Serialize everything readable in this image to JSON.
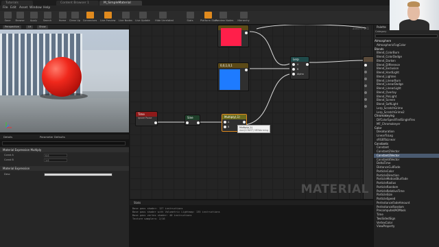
{
  "tabs": [
    {
      "label": "Tutorials"
    },
    {
      "label": "Content Browser 1"
    },
    {
      "label": "M_SimpleMaterial"
    }
  ],
  "menu": [
    "File",
    "Edit",
    "Asset",
    "Window",
    "Help"
  ],
  "toolbar": [
    {
      "label": "Save",
      "icon": "save-icon"
    },
    {
      "label": "Browse",
      "icon": "browse-icon"
    },
    {
      "label": "Apply",
      "icon": "apply-icon"
    },
    {
      "label": "Search",
      "icon": "search-icon"
    },
    {
      "label": "Home",
      "icon": "home-icon"
    },
    {
      "label": "Clean Up",
      "icon": "clean-up-icon"
    },
    {
      "label": "Connectors",
      "icon": "connectors-icon"
    },
    {
      "label": "Live Preview",
      "icon": "live-preview-icon"
    },
    {
      "label": "Live Nodes",
      "icon": "live-nodes-icon"
    },
    {
      "label": "Live Update",
      "icon": "live-update-icon"
    },
    {
      "label": "Hide Unrelated",
      "icon": "hide-unrelated-icon"
    },
    {
      "label": "Stats",
      "icon": "stats-icon"
    },
    {
      "label": "Platform Stats",
      "icon": "platform-stats-icon"
    },
    {
      "label": "Preview Nodes",
      "icon": "preview-nodes-icon"
    },
    {
      "label": "Hierarchy",
      "icon": "hierarchy-icon"
    }
  ],
  "viewport": {
    "buttons": [
      "Perspective",
      "Lit",
      "Show"
    ]
  },
  "details": {
    "tabs": [
      "Details",
      "Parameter Defaults"
    ],
    "section1": "Material Expression Multiply",
    "rows1": [
      {
        "label": "Const A",
        "value": "0.0"
      },
      {
        "label": "Const B",
        "value": "1.0"
      }
    ],
    "section2": "Material Expression",
    "rows2": [
      {
        "label": "Desc",
        "value": ""
      }
    ]
  },
  "graph": {
    "zoom": "Zoom 1:1",
    "watermark": "MATERIAL",
    "nodes": {
      "vector_red": {
        "title": ""
      },
      "vector_blue": {
        "title": "0,0,1,0,1"
      },
      "lerp": {
        "title": "Lerp",
        "pins": [
          "A",
          "B",
          "Alpha"
        ]
      },
      "time": {
        "title": "Time",
        "subtitle": "Ignore Pause"
      },
      "sine": {
        "title": "Sine"
      },
      "multiply": {
        "title": "Multiply(,1)",
        "pins": [
          "A",
          "B"
        ]
      },
      "tooltip": {
        "line1": "Multiply(,1)",
        "line2": "Add(CONST) MEWarming"
      }
    },
    "colors": {
      "red_vector": "#ff1f4a",
      "blue_vector": "#1e7bff",
      "time_head": "#8e1a1a",
      "multiply_head": "#6b6b1d"
    }
  },
  "stats": {
    "tab": "Stats",
    "lines": [
      "Base pass shader: 127 instructions",
      "Base pass shader with Volumetric Lightmap: 135 instructions",
      "Base pass vertex shader: 40 instructions",
      "Texture samplers: 2/16"
    ]
  },
  "palette": {
    "tab": "Palette",
    "category_label": "Category",
    "items": [
      {
        "label": "Atmosphere",
        "cat": true
      },
      {
        "label": "AtmosphericFogColor"
      },
      {
        "label": "Blends",
        "cat": true
      },
      {
        "label": "Blend_ColorBurn"
      },
      {
        "label": "Blend_ColorDodge"
      },
      {
        "label": "Blend_Darken"
      },
      {
        "label": "Blend_Difference"
      },
      {
        "label": "Blend_Exclusion"
      },
      {
        "label": "Blend_HardLight"
      },
      {
        "label": "Blend_Lighten"
      },
      {
        "label": "Blend_LinearBurn"
      },
      {
        "label": "Blend_LinearDodge"
      },
      {
        "label": "Blend_LinearLight"
      },
      {
        "label": "Blend_Overlay"
      },
      {
        "label": "Blend_PinLight"
      },
      {
        "label": "Blend_Screen"
      },
      {
        "label": "Blend_SoftLight"
      },
      {
        "label": "Lerp_ScratchGrime"
      },
      {
        "label": "Lerp_ScratchGrime2"
      },
      {
        "label": "Chromakeying",
        "cat": true
      },
      {
        "label": "DifColorSpectFindSingleFlex"
      },
      {
        "label": "MF_Chromakeyer"
      },
      {
        "label": "Color",
        "cat": true
      },
      {
        "label": "Desaturation"
      },
      {
        "label": "LinearToLog"
      },
      {
        "label": "sRGBToLinear"
      },
      {
        "label": "Constants",
        "cat": true
      },
      {
        "label": "Constant"
      },
      {
        "label": "Constant2Vector"
      },
      {
        "label": "Constant3Vector",
        "sel": true
      },
      {
        "label": "Constant4Vector"
      },
      {
        "label": "DeltaTime"
      },
      {
        "label": "DistanceCullFade"
      },
      {
        "label": "ParticleColor"
      },
      {
        "label": "ParticleDirection"
      },
      {
        "label": "ParticleMotionBlurFade"
      },
      {
        "label": "ParticleRadius"
      },
      {
        "label": "ParticleRandom"
      },
      {
        "label": "ParticleRelativeTime"
      },
      {
        "label": "ParticleSize"
      },
      {
        "label": "ParticleSpeed"
      },
      {
        "label": "PerInstanceFadeAmount"
      },
      {
        "label": "PerInstanceRandom"
      },
      {
        "label": "PrecomputedAOMask"
      },
      {
        "label": "Time"
      },
      {
        "label": "TwoSidedSign"
      },
      {
        "label": "VertexColor"
      },
      {
        "label": "ViewProperty"
      }
    ]
  }
}
